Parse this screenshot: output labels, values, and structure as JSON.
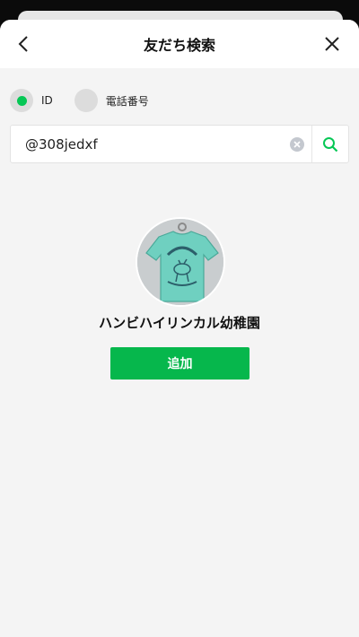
{
  "header": {
    "title": "友だち検索"
  },
  "search_type": {
    "options": [
      {
        "label": "ID",
        "selected": true
      },
      {
        "label": "電話番号",
        "selected": false
      }
    ]
  },
  "search": {
    "value": "@308jedxf"
  },
  "result": {
    "name": "ハンビハイリンカル幼稚園",
    "add_label": "追加"
  },
  "colors": {
    "accent": "#06c755",
    "button": "#06b74c"
  }
}
